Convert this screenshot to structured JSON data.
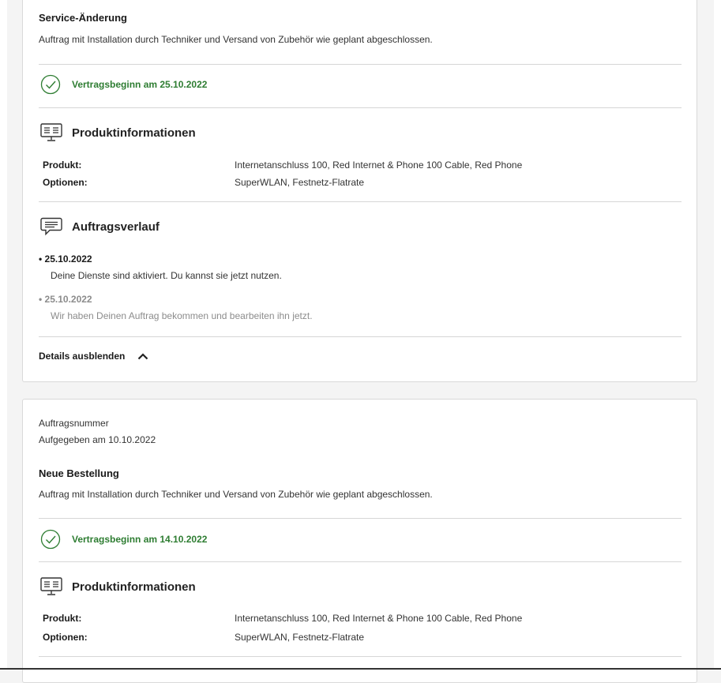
{
  "card1": {
    "heading": "Service-Änderung",
    "description": "Auftrag mit Installation durch Techniker und Versand von Zubehör wie geplant abgeschlossen.",
    "contract_start": "Vertragsbeginn am 25.10.2022",
    "product_section_title": "Produktinformationen",
    "product_label": "Produkt:",
    "product_value": "Internetanschluss 100, Red Internet & Phone 100 Cable, Red Phone",
    "options_label": "Optionen:",
    "options_value": "SuperWLAN, Festnetz-Flatrate",
    "history_title": "Auftragsverlauf",
    "history": [
      {
        "date": "25.10.2022",
        "text": "Deine Dienste sind aktiviert. Du kannst sie jetzt nutzen."
      },
      {
        "date": "25.10.2022",
        "text": "Wir haben Deinen Auftrag bekommen und bearbeiten ihn jetzt."
      }
    ],
    "toggle_label": "Details ausblenden"
  },
  "card2": {
    "order_number_label": "Auftragsnummer",
    "placed_on": "Aufgegeben am 10.10.2022",
    "heading": "Neue Bestellung",
    "description": "Auftrag mit Installation durch Techniker und Versand von Zubehör wie geplant abgeschlossen.",
    "contract_start": "Vertragsbeginn am 14.10.2022",
    "product_section_title": "Produktinformationen",
    "product_label": "Produkt:",
    "product_value": "Internetanschluss 100, Red Internet & Phone 100 Cable, Red Phone",
    "options_label": "Optionen:",
    "options_value": "SuperWLAN, Festnetz-Flatrate"
  },
  "colors": {
    "success": "#2e7d32",
    "divider": "#d6d6d6",
    "muted": "#8c8c8c"
  },
  "icons": [
    "check-circle-icon",
    "monitor-icon",
    "chat-bubble-icon",
    "chevron-up-icon"
  ]
}
